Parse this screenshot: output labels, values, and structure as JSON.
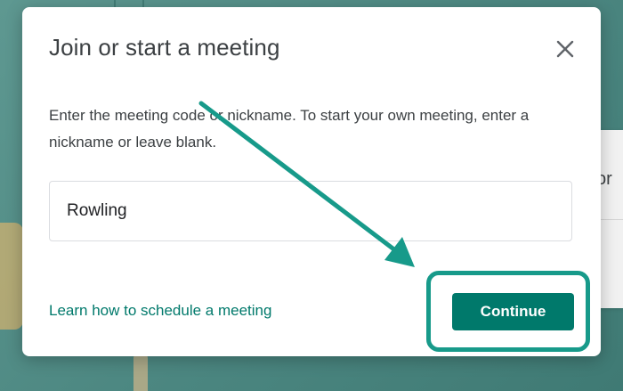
{
  "dialog": {
    "title": "Join or start a meeting",
    "close_icon": "close-icon",
    "instructions": "Enter the meeting code or nickname. To start your own meeting, enter a nickname or leave blank.",
    "input": {
      "value": "Rowling",
      "placeholder": ""
    },
    "learn_link": "Learn how to schedule a meeting",
    "continue_label": "Continue"
  },
  "background": {
    "card_fragment": "or"
  },
  "annotation": {
    "arrow_icon": "pointer-arrow-icon",
    "highlight": "continue-button-highlight"
  },
  "colors": {
    "accent": "#00796b",
    "annotation": "#179a8a",
    "backdrop": "#4f8a84",
    "title_text": "#3c4043"
  }
}
